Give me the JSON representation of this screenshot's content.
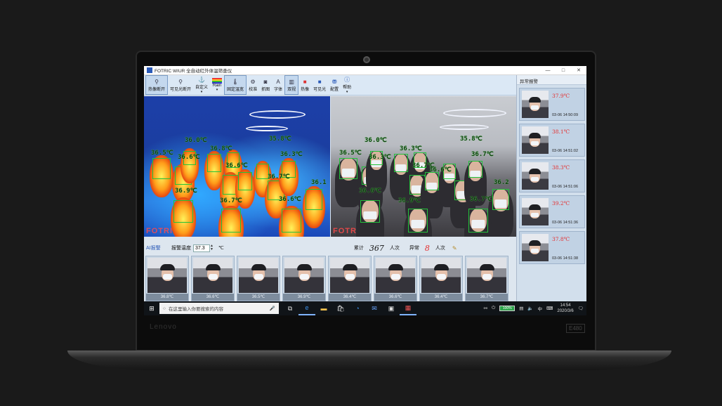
{
  "device": {
    "brand": "Lenovo",
    "model": "E480"
  },
  "window": {
    "title": "FOTRIC WIUR 全自动红外体温筛查仪",
    "minimize": "—",
    "maximize": "□",
    "close": "✕"
  },
  "toolbar": [
    {
      "icon": "person-run-icon",
      "glyph": "⚲",
      "label": "热像断开",
      "active": true
    },
    {
      "icon": "person-run-icon",
      "glyph": "⚲",
      "label": "可见光断开"
    },
    {
      "icon": "anchor-icon",
      "glyph": "⚓",
      "label": "自定义",
      "dropdown": true
    },
    {
      "icon": "palette-icon",
      "glyph": "",
      "label": "Rain",
      "dropdown": true
    },
    {
      "icon": "thermometer-icon",
      "glyph": "🌡",
      "label": "固定温宽",
      "active": true
    },
    {
      "icon": "gear-icon",
      "glyph": "⚙",
      "label": "校准"
    },
    {
      "icon": "camera-icon",
      "glyph": "◙",
      "label": "抓图"
    },
    {
      "icon": "font-icon",
      "glyph": "A",
      "label": "字体"
    },
    {
      "icon": "dual-view-icon",
      "glyph": "▥",
      "label": "双视",
      "active": true
    },
    {
      "icon": "thermal-view-icon",
      "glyph": "■",
      "label": "热像"
    },
    {
      "icon": "visible-view-icon",
      "glyph": "■",
      "label": "可见光"
    },
    {
      "icon": "config-icon",
      "glyph": "⛃",
      "label": "配置"
    },
    {
      "icon": "help-icon",
      "glyph": "ⓘ",
      "label": "帮助",
      "dropdown": true
    }
  ],
  "alarm_panel": {
    "title": "异常报警",
    "items": [
      {
        "temp": "37.9℃",
        "time": "03-06 14:50:09"
      },
      {
        "temp": "38.1℃",
        "time": "03-06 14:51:02"
      },
      {
        "temp": "38.3℃",
        "time": "03-06 14:51:06"
      },
      {
        "temp": "39.2℃",
        "time": "03-06 14:51:36"
      },
      {
        "temp": "37.8℃",
        "time": "03-06 14:51:38"
      }
    ]
  },
  "thermal_view": {
    "watermark": "FOTRIC",
    "labels": [
      "36.5℃",
      "36.0℃",
      "35.8℃",
      "36.8℃",
      "36.3℃",
      "36.6℃",
      "36.6℃",
      "36.7℃",
      "36.9℃",
      "36.7℃",
      "36.6℃",
      "36.1"
    ]
  },
  "visible_view": {
    "watermark": "FOTRIC",
    "labels": [
      "36.0℃",
      "35.8℃",
      "36.5℃",
      "36.3℃",
      "36.7℃",
      "36.3℃",
      "36.7℃",
      "36.6℃",
      "36.9℃",
      "36.7℃",
      "36.6℃",
      "36.2"
    ]
  },
  "stats": {
    "ai_label": "AI报警",
    "threshold_label": "报警温度",
    "threshold_value": "37.3",
    "threshold_unit": "℃",
    "total_label": "累计",
    "total_value": "367",
    "total_unit": "人次",
    "abnormal_label": "异常",
    "abnormal_value": "8",
    "abnormal_unit": "人次",
    "clear_icon": "broom-icon"
  },
  "thumbnails": [
    "36.8℃",
    "36.6℃",
    "36.5℃",
    "36.9℃",
    "36.4℃",
    "36.6℃",
    "36.4℃",
    "36.7℃"
  ],
  "taskbar": {
    "search_placeholder": "在这里输入你要搜索的内容",
    "battery": "100%",
    "ime": "中",
    "time": "14:54",
    "date": "2020/3/6"
  }
}
